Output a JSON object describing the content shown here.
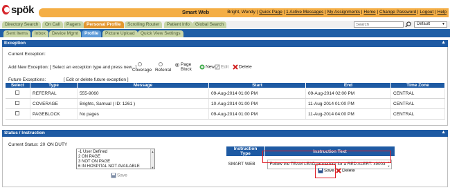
{
  "brand": {
    "name": "spök"
  },
  "header": {
    "title": "Smart Web",
    "user": "Bright, Wendy",
    "links": [
      "Quick Page",
      "1 Active Messages",
      "My Assignments",
      "Home",
      "Change Password",
      "Logout",
      "Help"
    ],
    "search_placeholder": "Search",
    "search_scope": "Default"
  },
  "tabs_primary": [
    "Directory Search",
    "On Call",
    "Pagers",
    "Personal Profile",
    "Scrolling Router",
    "Patient Info",
    "Global Search"
  ],
  "tabs_secondary": [
    "Sent Items",
    "Inbox",
    "Device Mgmt",
    "Profile",
    "Picture Upload",
    "Quick View Settings"
  ],
  "exception": {
    "section_title": "Exception",
    "collapse_glyph": "▲",
    "current_label": "Current Exception:",
    "add_label": "Add New Exception:",
    "add_hint": "[ Select an exception type and press new.. ]",
    "types": [
      "Coverage",
      "Referral",
      "Page Block"
    ],
    "selected_type": "Page Block",
    "actions": {
      "new": "New",
      "edit": "Edit",
      "delete": "Delete"
    },
    "future_label": "Future Exceptions:",
    "future_hint": "[ Edit or delete future exception ]",
    "columns": [
      "Select",
      "Type",
      "Message",
      "Start",
      "End",
      "Time Zone"
    ],
    "rows": [
      {
        "type": "REFERRAL",
        "message": "555-9060",
        "start": "09-Aug-2014 01:00 PM",
        "end": "09-Aug-2014 02:00 PM",
        "tz": "CENTRAL"
      },
      {
        "type": "COVERAGE",
        "message": "Brights, Samual ( ID: 1261 )",
        "start": "10-Aug-2014 01:00 PM",
        "end": "11-Aug-2014 01:00 PM",
        "tz": "CENTRAL"
      },
      {
        "type": "PAGEBLOCK",
        "message": "No pages",
        "start": "09-Aug-2014 01:00 PM",
        "end": "11-Aug-2014 04:00 PM",
        "tz": "CENTRAL"
      }
    ]
  },
  "status": {
    "section_title": "Status / Instruction",
    "collapse_glyph": "▲",
    "current_label": "Current Status:",
    "current_code": "20",
    "current_value": "ON DUTY",
    "options": [
      "-1 User Defined",
      "2 ON PAGE",
      "3 NOT ON PAGE",
      "6 IN HOSPITAL NOT AVAILABLE"
    ],
    "save_label": "Save",
    "instr_columns": [
      "Instruction Type",
      "Instruction Text"
    ],
    "instr_type": "SMART WEB",
    "instr_text": "Follow the TEAM LEAD procedure for a RED ALERT. x9003",
    "instr_save": "Save",
    "instr_delete": "Delete"
  },
  "colors": {
    "brand_orange": "#f4ae45",
    "nav_blue": "#1e5aa3",
    "highlight_red": "#e01b24"
  }
}
